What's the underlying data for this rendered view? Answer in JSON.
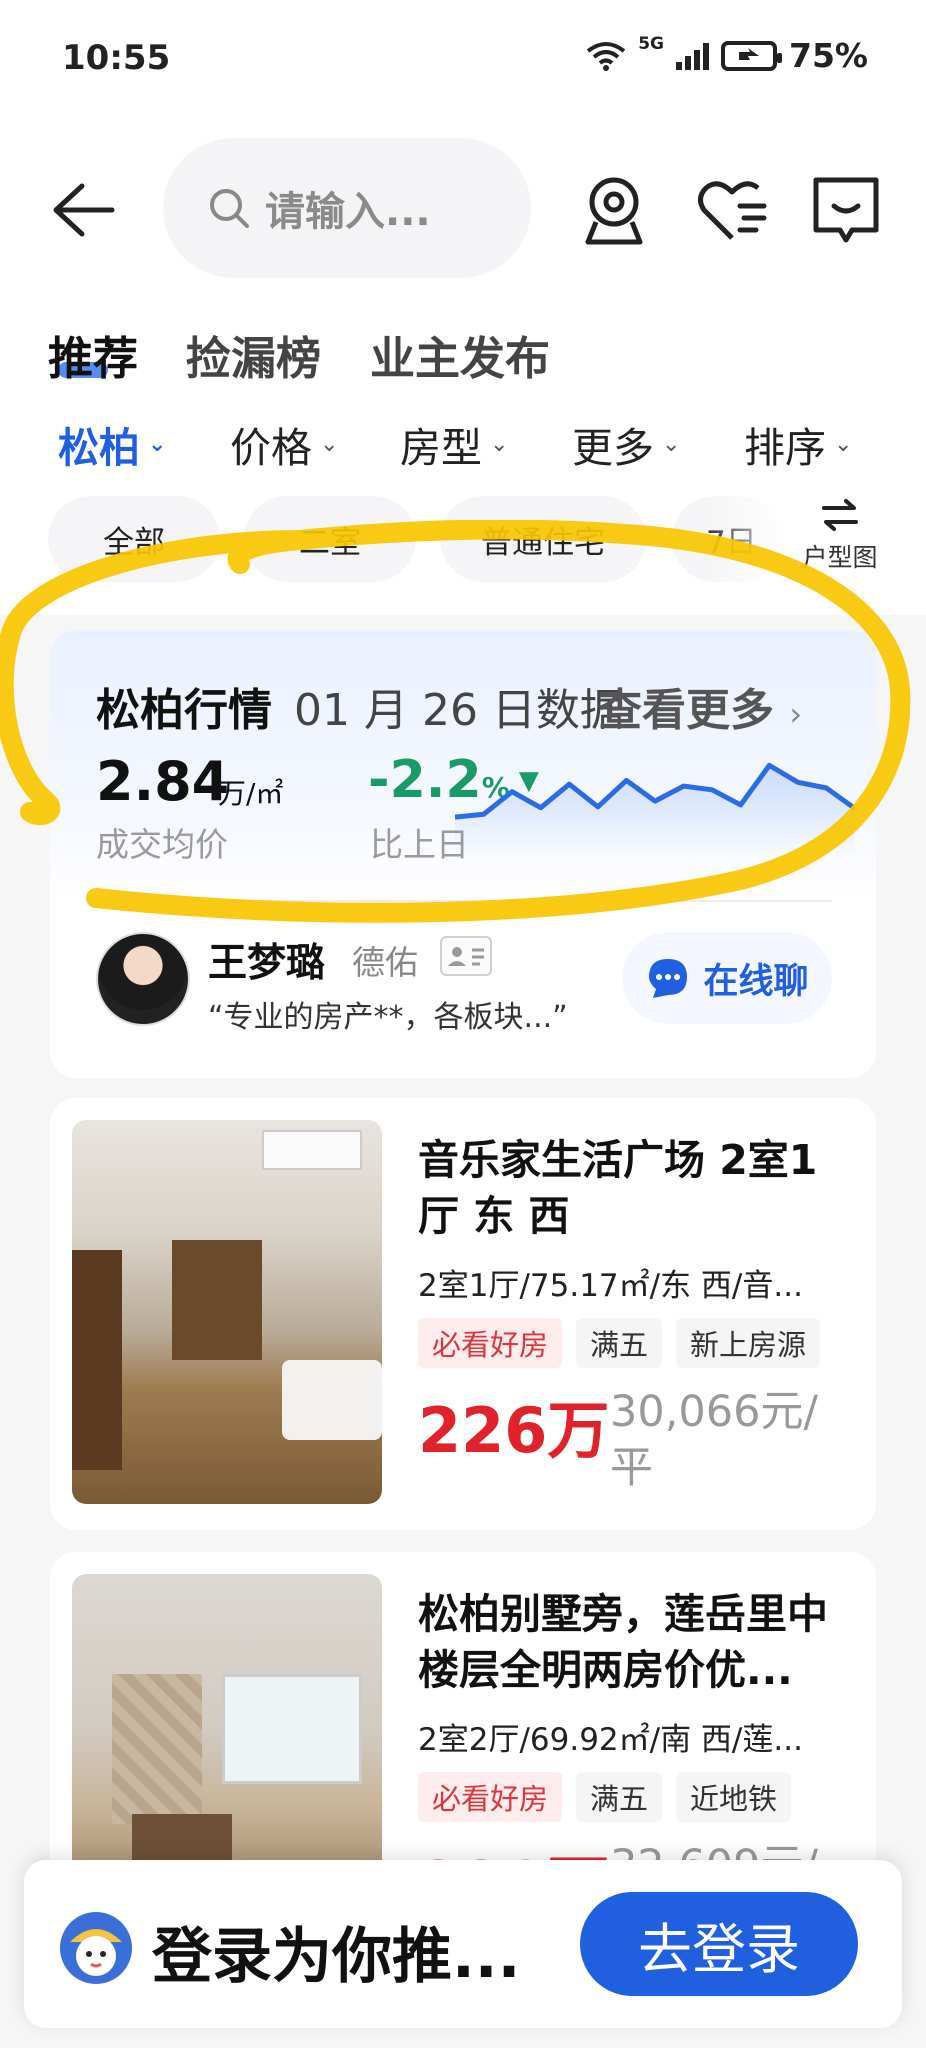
{
  "status_bar": {
    "time": "10:55",
    "network": "5G",
    "battery": "75%"
  },
  "search": {
    "placeholder": "请输入..."
  },
  "top_tabs": [
    "推荐",
    "捡漏榜",
    "业主发布"
  ],
  "filters": [
    "松柏",
    "价格",
    "房型",
    "更多",
    "排序"
  ],
  "chips": [
    "全部",
    "二室",
    "普通住宅",
    "7日"
  ],
  "floorplan_label": "户型图",
  "market": {
    "title": "松柏行情",
    "date": "01 月 26 日数据",
    "more": "查看更多",
    "avg_price": "2.84",
    "avg_price_unit": "万/㎡",
    "avg_price_label": "成交均价",
    "change": "-2.2",
    "change_unit": "%",
    "change_label": "比上日",
    "trend_values": [
      0.35,
      0.38,
      0.62,
      0.45,
      0.7,
      0.46,
      0.74,
      0.52,
      0.68,
      0.64,
      0.48,
      0.9,
      0.72,
      0.66,
      0.44
    ]
  },
  "agent": {
    "name": "王梦璐",
    "company": "德佑",
    "quote": "“专业的房产**，各板块...”",
    "chat_label": "在线聊"
  },
  "listings": [
    {
      "title": "音乐家生活广场 2室1厅 东 西",
      "specs": "2室1厅/75.17㎡/东 西/音...",
      "tags": [
        "必看好房",
        "满五",
        "新上房源"
      ],
      "price": "226万",
      "unit_price": "30,066元/平"
    },
    {
      "title": "松柏别墅旁，莲岳里中楼层全明两房价优...",
      "specs": "2室2厅/69.92㎡/南 西/莲...",
      "tags": [
        "必看好房",
        "满五",
        "近地铁"
      ],
      "price": "228万",
      "unit_price": "32,609元/"
    }
  ],
  "login_bar": {
    "text": "登录为你推...",
    "button": "去登录"
  },
  "colors": {
    "accent": "#1f5fe0",
    "price_red": "#e0232a",
    "down_green": "#1a9a66",
    "highlight": "#f7c600"
  }
}
